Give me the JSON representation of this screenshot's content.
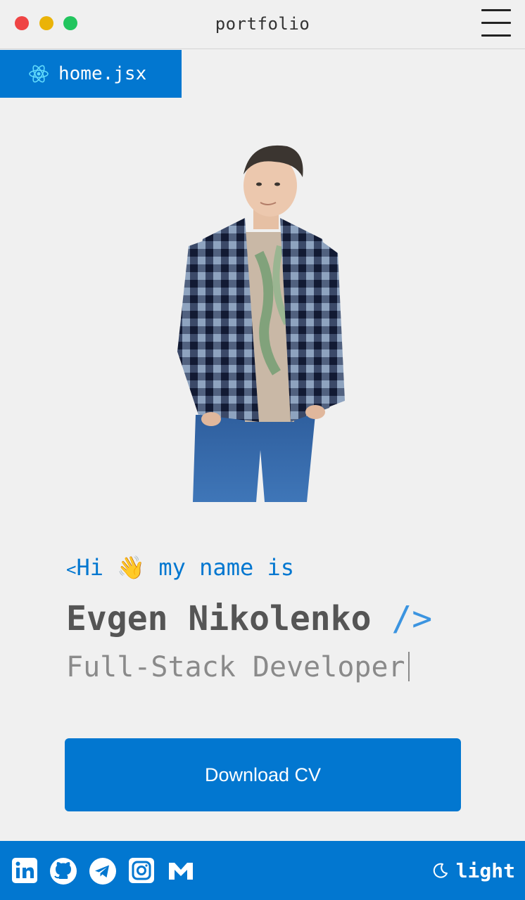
{
  "window": {
    "title": "portfolio"
  },
  "tab": {
    "label": "home.jsx",
    "icon": "react-icon"
  },
  "hero": {
    "greeting_open": "<",
    "greeting_text": "Hi ",
    "greeting_emoji": "👋",
    "greeting_rest": " my name is",
    "name": "Evgen Nikolenko",
    "name_close": " />",
    "role": "Full-Stack Developer"
  },
  "cta": {
    "download_label": "Download CV"
  },
  "footer": {
    "socials": [
      "linkedin-icon",
      "github-icon",
      "telegram-icon",
      "instagram-icon",
      "gmail-icon"
    ],
    "theme_label": "light",
    "theme_icon": "moon-icon"
  },
  "colors": {
    "accent": "#0277d0",
    "background": "#f0f0f0",
    "name_text": "#555555",
    "role_text": "#8a8a8a",
    "traffic_red": "#ef4444",
    "traffic_yellow": "#eab308",
    "traffic_green": "#22c55e"
  }
}
